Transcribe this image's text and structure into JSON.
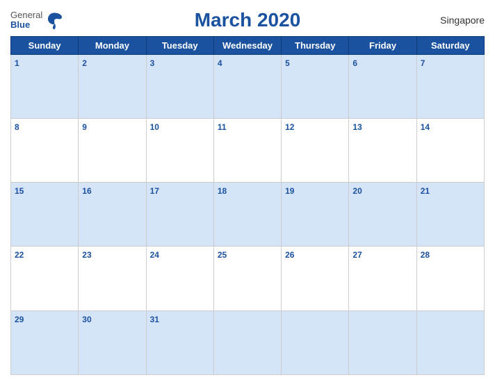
{
  "header": {
    "logo_general": "General",
    "logo_blue": "Blue",
    "title": "March 2020",
    "country": "Singapore"
  },
  "calendar": {
    "days_of_week": [
      "Sunday",
      "Monday",
      "Tuesday",
      "Wednesday",
      "Thursday",
      "Friday",
      "Saturday"
    ],
    "weeks": [
      [
        {
          "day": 1,
          "empty": false
        },
        {
          "day": 2,
          "empty": false
        },
        {
          "day": 3,
          "empty": false
        },
        {
          "day": 4,
          "empty": false
        },
        {
          "day": 5,
          "empty": false
        },
        {
          "day": 6,
          "empty": false
        },
        {
          "day": 7,
          "empty": false
        }
      ],
      [
        {
          "day": 8,
          "empty": false
        },
        {
          "day": 9,
          "empty": false
        },
        {
          "day": 10,
          "empty": false
        },
        {
          "day": 11,
          "empty": false
        },
        {
          "day": 12,
          "empty": false
        },
        {
          "day": 13,
          "empty": false
        },
        {
          "day": 14,
          "empty": false
        }
      ],
      [
        {
          "day": 15,
          "empty": false
        },
        {
          "day": 16,
          "empty": false
        },
        {
          "day": 17,
          "empty": false
        },
        {
          "day": 18,
          "empty": false
        },
        {
          "day": 19,
          "empty": false
        },
        {
          "day": 20,
          "empty": false
        },
        {
          "day": 21,
          "empty": false
        }
      ],
      [
        {
          "day": 22,
          "empty": false
        },
        {
          "day": 23,
          "empty": false
        },
        {
          "day": 24,
          "empty": false
        },
        {
          "day": 25,
          "empty": false
        },
        {
          "day": 26,
          "empty": false
        },
        {
          "day": 27,
          "empty": false
        },
        {
          "day": 28,
          "empty": false
        }
      ],
      [
        {
          "day": 29,
          "empty": false
        },
        {
          "day": 30,
          "empty": false
        },
        {
          "day": 31,
          "empty": false
        },
        {
          "day": null,
          "empty": true
        },
        {
          "day": null,
          "empty": true
        },
        {
          "day": null,
          "empty": true
        },
        {
          "day": null,
          "empty": true
        }
      ]
    ]
  }
}
